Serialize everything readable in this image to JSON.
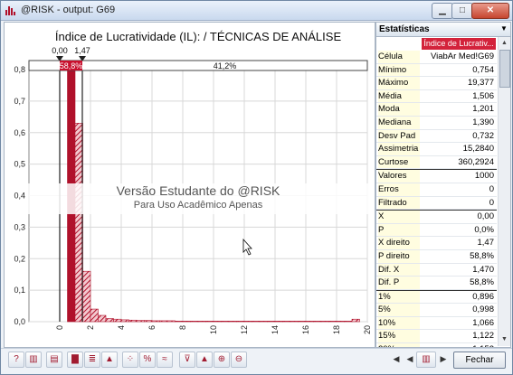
{
  "window": {
    "title": "@RISK - output: G69",
    "min_icon": "minimize-icon",
    "max_icon": "maximize-icon",
    "close_icon": "close-icon"
  },
  "chart_data": {
    "type": "bar",
    "title": "Índice de Lucratividade (IL): / TÉCNICAS DE ANÁLISE",
    "xlabel": "",
    "ylabel": "",
    "xlim": [
      -2,
      20
    ],
    "ylim": [
      0,
      0.8
    ],
    "x_ticks": [
      "0",
      "2",
      "4",
      "6",
      "8",
      "10",
      "12",
      "14",
      "16",
      "18",
      "20"
    ],
    "y_ticks": [
      "0,0",
      "0,1",
      "0,2",
      "0,3",
      "0,4",
      "0,5",
      "0,6",
      "0,7",
      "0,8"
    ],
    "bin_width": 0.5,
    "bins_start": [
      0.5,
      1.0,
      1.5,
      2.0,
      2.5,
      3.0,
      3.5,
      4.0,
      4.5,
      5.0,
      5.5,
      6.0,
      6.5,
      7.0,
      7.5,
      8.0,
      8.5,
      9.0,
      9.5,
      10.0,
      10.5,
      11.0,
      11.5,
      12.0,
      12.5,
      13.0,
      13.5,
      14.0,
      14.5,
      15.0,
      15.5,
      16.0,
      16.5,
      17.0,
      17.5,
      18.0,
      18.5,
      19.0
    ],
    "values": [
      0.8,
      0.63,
      0.16,
      0.04,
      0.02,
      0.01,
      0.008,
      0.006,
      0.005,
      0.004,
      0.004,
      0.003,
      0.003,
      0.003,
      0.002,
      0.002,
      0.002,
      0.002,
      0.002,
      0.002,
      0.002,
      0.002,
      0.002,
      0.002,
      0.002,
      0.002,
      0.002,
      0.002,
      0.002,
      0.002,
      0.002,
      0.002,
      0.002,
      0.002,
      0.002,
      0.002,
      0.002,
      0.008
    ],
    "delimiters": {
      "left_value": "0,00",
      "right_value": "1,47",
      "left_x": 0.0,
      "right_x": 1.47
    },
    "region_labels": {
      "left": "",
      "middle": "41,2%",
      "right": "58,8%"
    },
    "colors": {
      "bar": "#b0112b",
      "bar_light": "#d9646f",
      "region_left": "#c8102e"
    },
    "grid": true,
    "legend": "none"
  },
  "watermark": {
    "line1": "Versão Estudante do @RISK",
    "line2": "Para Uso Acadêmico Apenas"
  },
  "stats": {
    "header": "Estatísticas",
    "column_header": "Índice de Lucrativ...",
    "rows": [
      {
        "k": "Célula",
        "v": "ViabAr Med!G69"
      },
      {
        "k": "Mínimo",
        "v": "0,754"
      },
      {
        "k": "Máximo",
        "v": "19,377"
      },
      {
        "k": "Média",
        "v": "1,506"
      },
      {
        "k": "Moda",
        "v": "1,201"
      },
      {
        "k": "Mediana",
        "v": "1,390"
      },
      {
        "k": "Desv Pad",
        "v": "0,732"
      },
      {
        "k": "Assimetria",
        "v": "15,2840"
      },
      {
        "k": "Curtose",
        "v": "360,2924"
      },
      {
        "k": "Valores",
        "v": "1000"
      },
      {
        "k": "Erros",
        "v": "0"
      },
      {
        "k": "Filtrado",
        "v": "0"
      },
      {
        "k": "X esquerdo",
        "v": "0,00"
      },
      {
        "k": "P esquerdo",
        "v": "0,0%"
      },
      {
        "k": "X direito",
        "v": "1,47"
      },
      {
        "k": "P direito",
        "v": "58,8%"
      },
      {
        "k": "Dif. X",
        "v": "1,470"
      },
      {
        "k": "Dif. P",
        "v": "58,8%"
      },
      {
        "k": "1%",
        "v": "0,896"
      },
      {
        "k": "5%",
        "v": "0,998"
      },
      {
        "k": "10%",
        "v": "1,066"
      },
      {
        "k": "15%",
        "v": "1,122"
      },
      {
        "k": "20%",
        "v": "1,152"
      }
    ],
    "separators_before": [
      9,
      12,
      18
    ]
  },
  "toolbar": {
    "buttons": [
      "help-icon",
      "summary-icon",
      "histogram-icon",
      "cumulative-icon",
      "density-icon",
      "scatter-icon",
      "percent-icon",
      "graph-options-icon",
      "filter-icon",
      "zoom-graph-icon",
      "zoom-in-icon",
      "zoom-out-icon"
    ],
    "close_label": "Fechar"
  }
}
